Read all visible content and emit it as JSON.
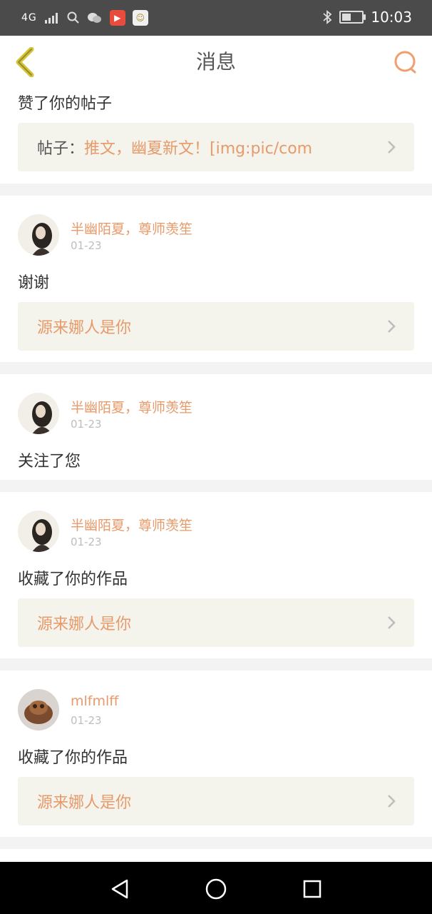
{
  "status_bar": {
    "network": "4G",
    "signal_text": "4G",
    "time": "10:03",
    "icons": [
      "signal-icon",
      "search-icon",
      "wechat-icon",
      "app-red-icon",
      "app-yellow-icon",
      "bluetooth-icon",
      "battery-icon"
    ]
  },
  "header": {
    "title": "消息",
    "back_icon": "chevron-left-icon",
    "search_icon": "search-icon",
    "colors": {
      "back": "#d4c63a",
      "search": "#f0a070"
    }
  },
  "items": [
    {
      "text": "赞了你的帖子",
      "link": {
        "label": "帖子：",
        "value": "推文，幽夏新文！[img:pic/com"
      }
    },
    {
      "user": "半幽陌夏，尊师羡笙",
      "date": "01-23",
      "text": "谢谢",
      "link": {
        "value": "源来娜人是你"
      }
    },
    {
      "user": "半幽陌夏，尊师羡笙",
      "date": "01-23",
      "text": "关注了您"
    },
    {
      "user": "半幽陌夏，尊师羡笙",
      "date": "01-23",
      "text": "收藏了你的作品",
      "link": {
        "value": "源来娜人是你"
      }
    },
    {
      "user": "mlfmlff",
      "date": "01-23",
      "text": "收藏了你的作品",
      "link": {
        "value": "源来娜人是你"
      }
    }
  ],
  "colors": {
    "accent": "#e79a6a",
    "link_bg": "#f4f3ec",
    "status_bar": "#4b4b4b",
    "nav_bar": "#000000"
  }
}
